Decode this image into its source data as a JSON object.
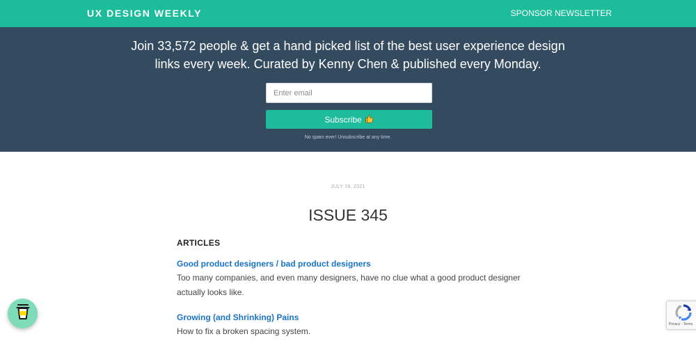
{
  "header": {
    "brand": "UX DESIGN WEEKLY",
    "sponsor_link": "SPONSOR NEWSLETTER"
  },
  "hero": {
    "line1": "Join 33,572 people & get a hand picked list of the best user experience design",
    "line2": "links every week. Curated by Kenny Chen & published every Monday.",
    "email_placeholder": "Enter email",
    "subscribe_label": "Subscribe",
    "no_spam": "No spam ever! Unsubscribe at any time."
  },
  "issue": {
    "date": "JULY 19, 2021",
    "title": "ISSUE 345",
    "section": "ARTICLES",
    "articles": [
      {
        "title": "Good product designers / bad product designers",
        "description": "Too many companies, and even many designers, have no clue what a good product designer actually looks like."
      },
      {
        "title": "Growing (and Shrinking) Pains",
        "description": "How to fix a broken spacing system."
      }
    ]
  },
  "widgets": {
    "coffee_icon": "coffee-cup-icon",
    "recaptcha_links": "Privacy - Terms"
  },
  "colors": {
    "accent": "#1dbc9c",
    "hero_bg": "#344a5f",
    "link": "#1a73c7"
  }
}
